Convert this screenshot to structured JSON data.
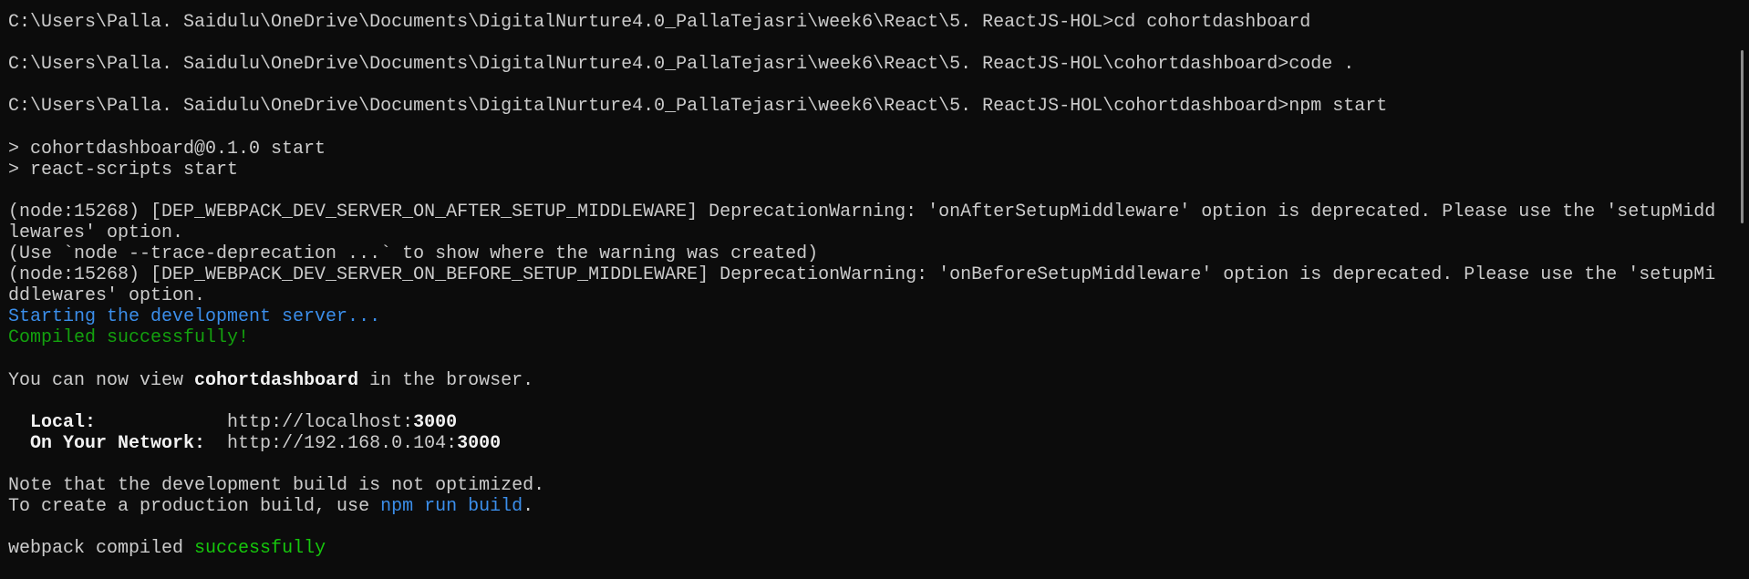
{
  "colors": {
    "background": "#0c0c0c",
    "text": "#cccccc",
    "bold": "#f2f2f2",
    "blue": "#3b8eea",
    "green": "#13a10e",
    "bright_green": "#16c60c"
  },
  "terminal": {
    "lines": [
      [
        {
          "text": "C:\\Users\\Palla. Saidulu\\OneDrive\\Documents\\DigitalNurture4.0_PallaTejasri\\week6\\React\\5. ReactJS-HOL>cd cohortdashboard",
          "style": "normal"
        }
      ],
      [],
      [
        {
          "text": "C:\\Users\\Palla. Saidulu\\OneDrive\\Documents\\DigitalNurture4.0_PallaTejasri\\week6\\React\\5. ReactJS-HOL\\cohortdashboard>code .",
          "style": "normal"
        }
      ],
      [],
      [
        {
          "text": "C:\\Users\\Palla. Saidulu\\OneDrive\\Documents\\DigitalNurture4.0_PallaTejasri\\week6\\React\\5. ReactJS-HOL\\cohortdashboard>npm start",
          "style": "normal"
        }
      ],
      [],
      [
        {
          "text": "> cohortdashboard@0.1.0 start",
          "style": "normal"
        }
      ],
      [
        {
          "text": "> react-scripts start",
          "style": "normal"
        }
      ],
      [],
      [
        {
          "text": "(node:15268) [DEP_WEBPACK_DEV_SERVER_ON_AFTER_SETUP_MIDDLEWARE] DeprecationWarning: 'onAfterSetupMiddleware' option is deprecated. Please use the 'setupMidd",
          "style": "normal"
        }
      ],
      [
        {
          "text": "lewares' option.",
          "style": "normal"
        }
      ],
      [
        {
          "text": "(Use `node --trace-deprecation ...` to show where the warning was created)",
          "style": "normal"
        }
      ],
      [
        {
          "text": "(node:15268) [DEP_WEBPACK_DEV_SERVER_ON_BEFORE_SETUP_MIDDLEWARE] DeprecationWarning: 'onBeforeSetupMiddleware' option is deprecated. Please use the 'setupMi",
          "style": "normal"
        }
      ],
      [
        {
          "text": "ddlewares' option.",
          "style": "normal"
        }
      ],
      [
        {
          "text": "Starting the development server...",
          "style": "blue"
        }
      ],
      [
        {
          "text": "Compiled successfully!",
          "style": "green"
        }
      ],
      [],
      [
        {
          "text": "You can now view ",
          "style": "normal"
        },
        {
          "text": "cohortdashboard",
          "style": "bold"
        },
        {
          "text": " in the browser.",
          "style": "normal"
        }
      ],
      [],
      [
        {
          "text": "  ",
          "style": "normal"
        },
        {
          "text": "Local:",
          "style": "bold"
        },
        {
          "text": "            http://localhost:",
          "style": "normal"
        },
        {
          "text": "3000",
          "style": "bold"
        }
      ],
      [
        {
          "text": "  ",
          "style": "normal"
        },
        {
          "text": "On Your Network:",
          "style": "bold"
        },
        {
          "text": "  http://192.168.0.104:",
          "style": "normal"
        },
        {
          "text": "3000",
          "style": "bold"
        }
      ],
      [],
      [
        {
          "text": "Note that the development build is not optimized.",
          "style": "normal"
        }
      ],
      [
        {
          "text": "To create a production build, use ",
          "style": "normal"
        },
        {
          "text": "npm run build",
          "style": "blue"
        },
        {
          "text": ".",
          "style": "normal"
        }
      ],
      [],
      [
        {
          "text": "webpack compiled ",
          "style": "normal"
        },
        {
          "text": "successfully",
          "style": "bright-green"
        }
      ]
    ]
  }
}
